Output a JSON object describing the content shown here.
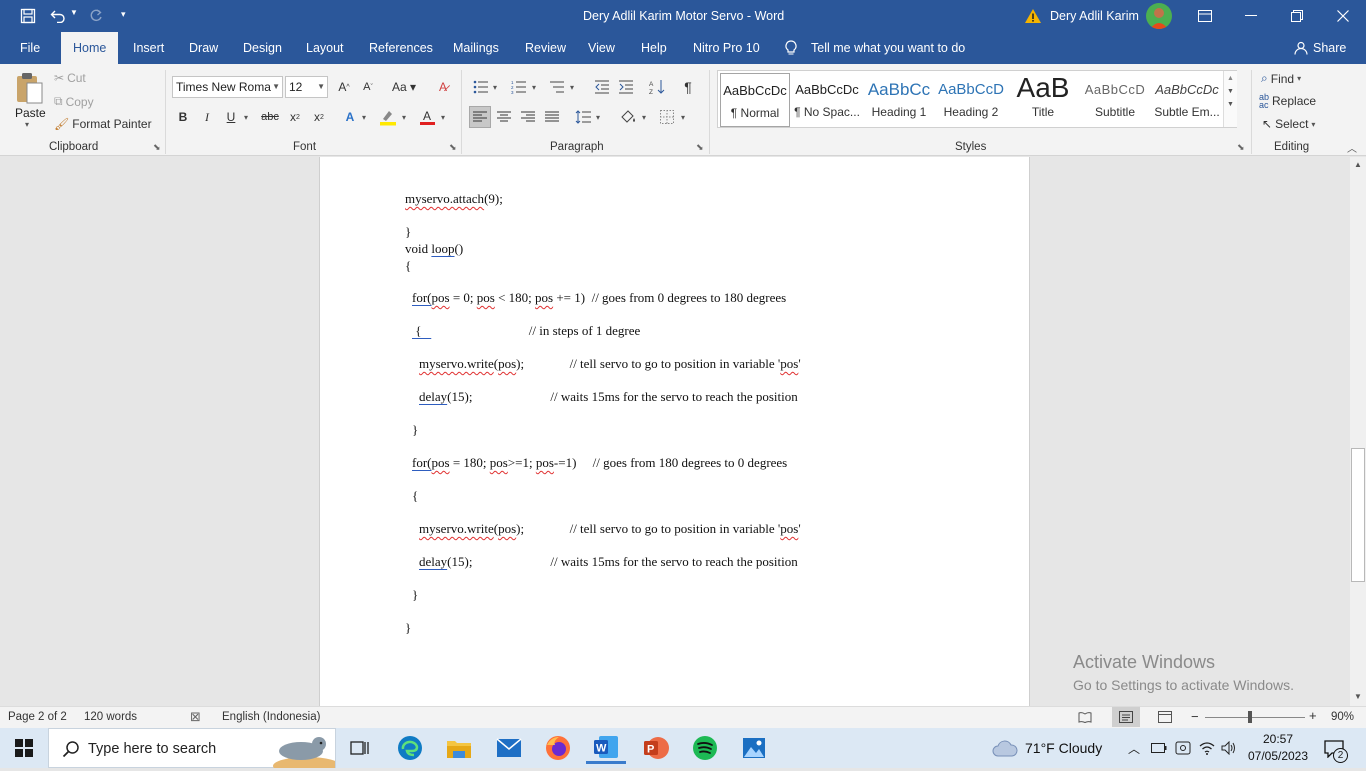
{
  "window": {
    "title": "Dery Adlil Karim Motor Servo  -  Word",
    "user": "Dery Adlil Karim"
  },
  "tabs": [
    {
      "label": "File"
    },
    {
      "label": "Home"
    },
    {
      "label": "Insert"
    },
    {
      "label": "Draw"
    },
    {
      "label": "Design"
    },
    {
      "label": "Layout"
    },
    {
      "label": "References"
    },
    {
      "label": "Mailings"
    },
    {
      "label": "Review"
    },
    {
      "label": "View"
    },
    {
      "label": "Help"
    },
    {
      "label": "Nitro Pro 10"
    }
  ],
  "tellme": "Tell me what you want to do",
  "share": "Share",
  "clipboard": {
    "paste": "Paste",
    "cut": "Cut",
    "copy": "Copy",
    "format_painter": "Format Painter",
    "label": "Clipboard"
  },
  "font": {
    "name": "Times New Roma",
    "size": "12",
    "label": "Font"
  },
  "paragraph": {
    "label": "Paragraph"
  },
  "styles": {
    "label": "Styles",
    "items": [
      {
        "preview": "AaBbCcDc",
        "name": "¶ Normal"
      },
      {
        "preview": "AaBbCcDc",
        "name": "¶ No Spac..."
      },
      {
        "preview": "AaBbCc",
        "name": "Heading 1"
      },
      {
        "preview": "AaBbCcD",
        "name": "Heading 2"
      },
      {
        "preview": "AaB",
        "name": "Title"
      },
      {
        "preview": "AaBbCcD",
        "name": "Subtitle"
      },
      {
        "preview": "AaBbCcDc",
        "name": "Subtle Em..."
      }
    ]
  },
  "editing": {
    "find": "Find",
    "replace": "Replace",
    "select": "Select",
    "label": "Editing"
  },
  "document": {
    "lines": [
      "  myservo.attach(9);",
      "}",
      "void loop()",
      "{",
      "  for(pos = 0; pos < 180; pos += 1)  // goes from 0 degrees to 180 degrees",
      "  {                                 // in steps of 1 degree",
      "    myservo.write(pos);              // tell servo to go to position in variable 'pos'",
      "    delay(15);                       // waits 15ms for the servo to reach the position",
      "  }",
      "  for(pos = 180; pos>=1; pos-=1)     // goes from 180 degrees to 0 degrees",
      "  {",
      "    myservo.write(pos);              // tell servo to go to position in variable 'pos'",
      "    delay(15);                       // waits 15ms for the servo to reach the position",
      "  }",
      "}"
    ]
  },
  "watermark": {
    "title": "Activate Windows",
    "subtitle": "Go to Settings to activate Windows."
  },
  "status": {
    "page": "Page 2 of 2",
    "words": "120 words",
    "language": "English (Indonesia)",
    "zoom": "90%"
  },
  "taskbar": {
    "search_placeholder": "Type here to search",
    "weather": "71°F  Cloudy",
    "time": "20:57",
    "date": "07/05/2023",
    "notifications": "2"
  },
  "colors": {
    "word_blue": "#2b579a",
    "ribbon_bg": "#f3f3f3"
  }
}
